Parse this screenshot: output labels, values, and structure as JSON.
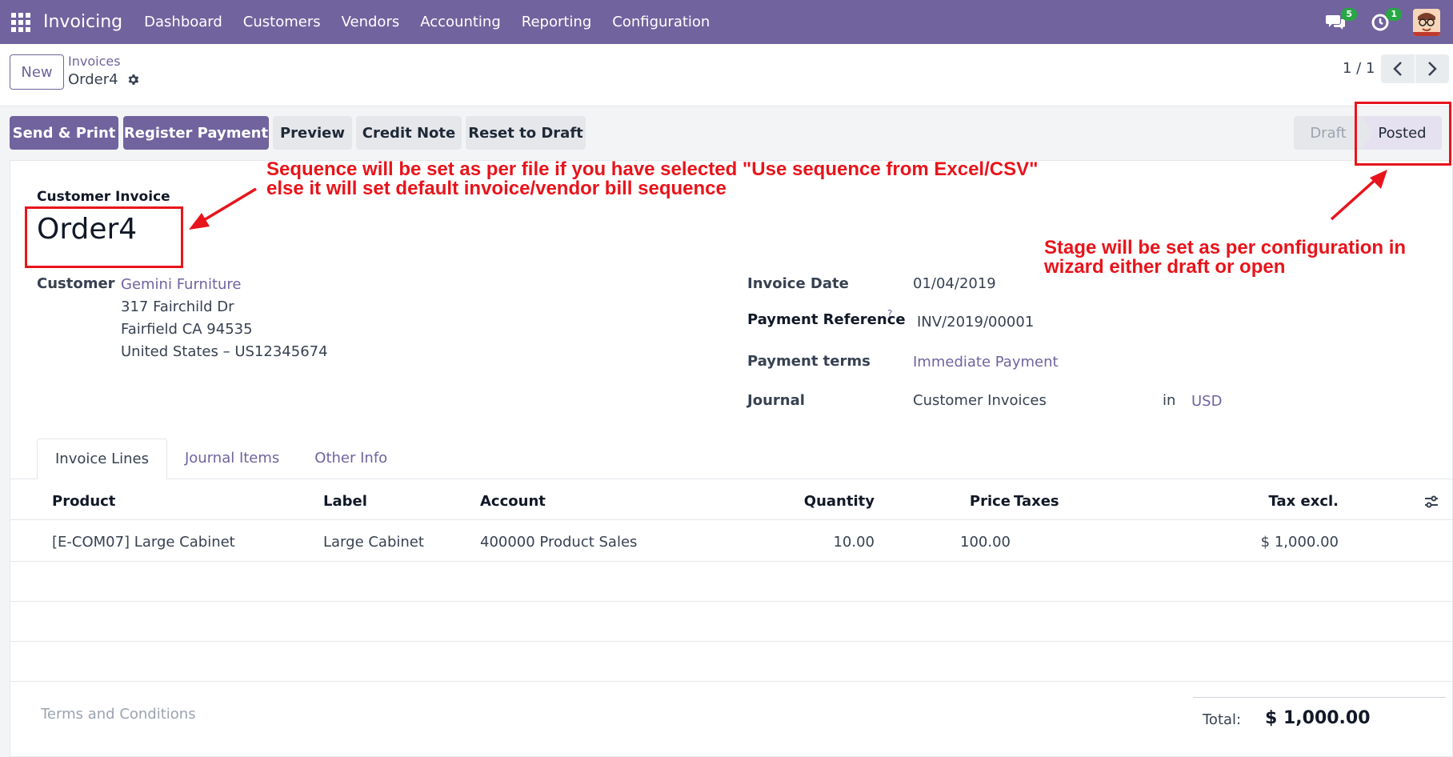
{
  "navbar": {
    "app_name": "Invoicing",
    "menu": [
      "Dashboard",
      "Customers",
      "Vendors",
      "Accounting",
      "Reporting",
      "Configuration"
    ],
    "messages_count": "5",
    "activities_count": "1"
  },
  "control_panel": {
    "new_label": "New",
    "breadcrumb_parent": "Invoices",
    "breadcrumb_current": "Order4",
    "pager_value": "1 / 1"
  },
  "actions": {
    "send_print": "Send & Print",
    "register_payment": "Register Payment",
    "preview": "Preview",
    "credit_note": "Credit Note",
    "reset_draft": "Reset to Draft"
  },
  "status": {
    "draft": "Draft",
    "posted": "Posted"
  },
  "form": {
    "doc_type": "Customer Invoice",
    "name": "Order4",
    "customer_label": "Customer",
    "customer_name": "Gemini Furniture",
    "address_line1": "317 Fairchild Dr",
    "address_line2": "Fairfield CA 94535",
    "address_line3": "United States – US12345674",
    "invoice_date_label": "Invoice Date",
    "invoice_date": "01/04/2019",
    "payment_ref_label": "Payment Reference",
    "payment_ref_help": "?",
    "payment_ref": "INV/2019/00001",
    "payment_terms_label": "Payment terms",
    "payment_terms": "Immediate Payment",
    "journal_label": "Journal",
    "journal": "Customer Invoices",
    "in_label": "in",
    "currency": "USD"
  },
  "tabs": [
    "Invoice Lines",
    "Journal Items",
    "Other Info"
  ],
  "lines": {
    "headers": {
      "product": "Product",
      "label": "Label",
      "account": "Account",
      "quantity": "Quantity",
      "price": "Price",
      "taxes": "Taxes",
      "tax_excl": "Tax excl."
    },
    "rows": [
      {
        "product": "[E-COM07] Large Cabinet",
        "label": "Large Cabinet",
        "account": "400000 Product Sales",
        "quantity": "10.00",
        "price": "100.00",
        "taxes": "",
        "tax_excl": "$ 1,000.00"
      }
    ]
  },
  "footer": {
    "terms_placeholder": "Terms and Conditions",
    "total_label": "Total:",
    "total_value": "$ 1,000.00"
  },
  "annotations": {
    "sequence_line1": "Sequence will be set as per file if you have selected \"Use sequence from Excel/CSV\"",
    "sequence_line2": "else it will set default invoice/vendor bill sequence",
    "stage_line1": "Stage will be set as per configuration in",
    "stage_line2": "wizard either draft or open",
    "color": "#e8141b"
  },
  "colors": {
    "brand": "#71639e",
    "badge": "#28a745"
  }
}
